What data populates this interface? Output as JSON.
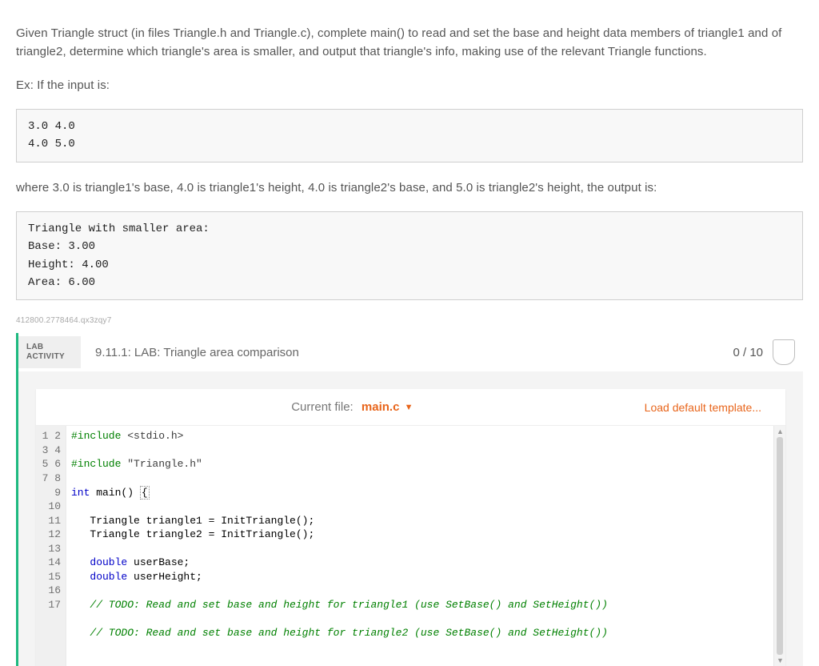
{
  "intro": {
    "p1": "Given Triangle struct (in files Triangle.h and Triangle.c), complete main() to read and set the base and height data members of triangle1 and of triangle2, determine which triangle's area is smaller, and output that triangle's info, making use of the relevant Triangle functions.",
    "p2": "Ex: If the input is:"
  },
  "input_block": "3.0 4.0\n4.0 5.0",
  "mid_text": "where 3.0 is triangle1's base, 4.0 is triangle1's height, 4.0 is triangle2's base, and 5.0 is triangle2's height, the output is:",
  "output_block": "Triangle with smaller area:\nBase: 3.00\nHeight: 4.00\nArea: 6.00",
  "watermark": "412800.2778464.qx3zqy7",
  "lab": {
    "badge_line1": "LAB",
    "badge_line2": "ACTIVITY",
    "title": "9.11.1: LAB: Triangle area comparison",
    "score": "0 / 10"
  },
  "editor": {
    "current_file_label": "Current file:",
    "current_file_name": "main.c",
    "load_template": "Load default template..."
  },
  "gutter": "1\n2\n3\n4\n5\n6\n7\n8\n9\n10\n11\n12\n13\n14\n15\n16\n17",
  "code": {
    "l1_a": "#include",
    "l1_b": " <stdio.h>",
    "l3_a": "#include",
    "l3_b": " \"Triangle.h\"",
    "l5_a": "int",
    "l5_b": " main() ",
    "l5_c": "{",
    "l7": "   Triangle triangle1 = InitTriangle();",
    "l8": "   Triangle triangle2 = InitTriangle();",
    "l10_a": "   ",
    "l10_b": "double",
    "l10_c": " userBase;",
    "l11_a": "   ",
    "l11_b": "double",
    "l11_c": " userHeight;",
    "l13": "   // TODO: Read and set base and height for triangle1 (use SetBase() and SetHeight())",
    "l15": "   // TODO: Read and set base and height for triangle2 (use SetBase() and SetHeight())"
  }
}
